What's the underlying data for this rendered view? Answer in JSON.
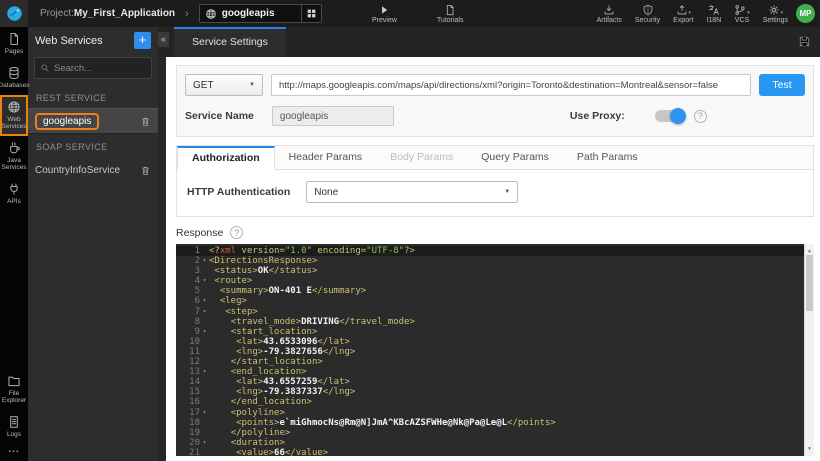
{
  "colors": {
    "accent_blue": "#2a84e8",
    "highlight_orange": "#e8830d",
    "avatar_green": "#43ae4d",
    "test_button_blue": "#2897f2",
    "editor_background": "#2b2b2b",
    "editor_tag": "#c9c272",
    "editor_string": "#8cc152"
  },
  "topbar": {
    "project_label": "Project:",
    "project_name": "My_First_Application",
    "breadcrumb_chevron": "›",
    "service_selector": "googleapis",
    "center_items": [
      {
        "id": "preview",
        "label": "Preview",
        "icon": "play"
      },
      {
        "id": "tutorials",
        "label": "Tutorials",
        "icon": "tutorials"
      }
    ],
    "right_items": [
      {
        "id": "artifacts",
        "label": "Artifacts",
        "icon": "artifacts",
        "caret": false
      },
      {
        "id": "security",
        "label": "Security",
        "icon": "security",
        "caret": false
      },
      {
        "id": "export",
        "label": "Export",
        "icon": "export",
        "caret": true
      },
      {
        "id": "i18n",
        "label": "I18N",
        "icon": "i18n",
        "caret": false
      },
      {
        "id": "vcs",
        "label": "VCS",
        "icon": "vcs",
        "caret": true
      },
      {
        "id": "settings",
        "label": "Settings",
        "icon": "settings",
        "caret": true
      }
    ],
    "avatar_initials": "MP"
  },
  "activity_bar": {
    "items": [
      {
        "id": "pages",
        "label": "Pages",
        "icon": "page",
        "active": false
      },
      {
        "id": "databases",
        "label": "Databases",
        "icon": "db",
        "active": false
      },
      {
        "id": "web-services",
        "label": "Web Services",
        "icon": "globe",
        "active": true
      },
      {
        "id": "java-services",
        "label": "Java Services",
        "icon": "java",
        "active": false
      },
      {
        "id": "apis",
        "label": "APIs",
        "icon": "plug",
        "active": false
      }
    ],
    "bottom_items": [
      {
        "id": "file-explorer",
        "label": "File Explorer",
        "icon": "folder"
      },
      {
        "id": "logs",
        "label": "Logs",
        "icon": "logs"
      }
    ],
    "more_label": "..."
  },
  "services_panel": {
    "title": "Web Services",
    "add_button": "+",
    "collapse_glyph": "«",
    "search_placeholder": "Search...",
    "sections": [
      {
        "header": "REST SERVICE",
        "items": [
          {
            "name": "googleapis",
            "highlighted": true
          }
        ]
      },
      {
        "header": "SOAP SERVICE",
        "items": [
          {
            "name": "CountryInfoService",
            "highlighted": false
          }
        ]
      }
    ]
  },
  "main": {
    "tab_label": "Service Settings",
    "request": {
      "method": "GET",
      "url": "http://maps.googleapis.com/maps/api/directions/xml?origin=Toronto&destination=Montreal&sensor=false",
      "test_label": "Test",
      "service_name_label": "Service Name",
      "service_name_value": "googleapis",
      "use_proxy_label": "Use Proxy:",
      "use_proxy_on": true
    },
    "param_tabs": [
      {
        "label": "Authorization",
        "state": "active"
      },
      {
        "label": "Header Params",
        "state": "normal"
      },
      {
        "label": "Body Params",
        "state": "disabled"
      },
      {
        "label": "Query Params",
        "state": "normal"
      },
      {
        "label": "Path Params",
        "state": "normal"
      }
    ],
    "authorization": {
      "label": "HTTP Authentication",
      "value": "None"
    },
    "response_label": "Response",
    "editor": {
      "active_line": 1,
      "lines": [
        {
          "n": 1,
          "fold": false,
          "text": "<?xml version=\"1.0\" encoding=\"UTF-8\"?>"
        },
        {
          "n": 2,
          "fold": true,
          "text": "<DirectionsResponse>"
        },
        {
          "n": 3,
          "fold": false,
          "text": " <status>OK</status>"
        },
        {
          "n": 4,
          "fold": true,
          "text": " <route>"
        },
        {
          "n": 5,
          "fold": false,
          "text": "  <summary>ON-401 E</summary>"
        },
        {
          "n": 6,
          "fold": true,
          "text": "  <leg>"
        },
        {
          "n": 7,
          "fold": true,
          "text": "   <step>"
        },
        {
          "n": 8,
          "fold": false,
          "text": "    <travel_mode>DRIVING</travel_mode>"
        },
        {
          "n": 9,
          "fold": true,
          "text": "    <start_location>"
        },
        {
          "n": 10,
          "fold": false,
          "text": "     <lat>43.6533096</lat>"
        },
        {
          "n": 11,
          "fold": false,
          "text": "     <lng>-79.3827656</lng>"
        },
        {
          "n": 12,
          "fold": false,
          "text": "    </start_location>"
        },
        {
          "n": 13,
          "fold": true,
          "text": "    <end_location>"
        },
        {
          "n": 14,
          "fold": false,
          "text": "     <lat>43.6557259</lat>"
        },
        {
          "n": 15,
          "fold": false,
          "text": "     <lng>-79.3837337</lng>"
        },
        {
          "n": 16,
          "fold": false,
          "text": "    </end_location>"
        },
        {
          "n": 17,
          "fold": true,
          "text": "    <polyline>"
        },
        {
          "n": 18,
          "fold": false,
          "text": "     <points>e`miGhmocNs@Rm@N]JmA^KBcAZSFWHe@Nk@Pa@Le@L</points>"
        },
        {
          "n": 19,
          "fold": false,
          "text": "    </polyline>"
        },
        {
          "n": 20,
          "fold": true,
          "text": "    <duration>"
        },
        {
          "n": 21,
          "fold": false,
          "text": "     <value>66</value>"
        }
      ]
    }
  }
}
